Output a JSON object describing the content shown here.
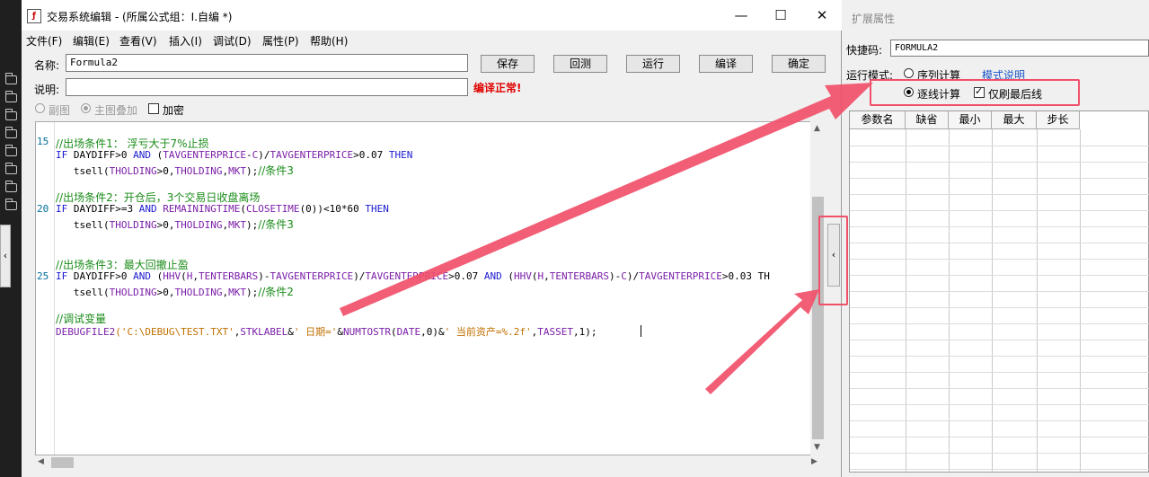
{
  "window": {
    "title": "交易系统编辑 - (所属公式组：I.自编 *)",
    "icon_name": "formula-app-icon",
    "minimize_glyph": "—",
    "maximize_glyph": "☐",
    "close_glyph": "✕"
  },
  "menu": [
    "文件(F)",
    "编辑(E)",
    "查看(V)",
    "插入(I)",
    "调试(D)",
    "属性(P)",
    "帮助(H)"
  ],
  "form": {
    "name_label": "名称:",
    "name_value": "Formula2",
    "desc_label": "说明:",
    "desc_value": "",
    "status": "编译正常!",
    "buttons": [
      "保存",
      "回测",
      "运行",
      "编译",
      "确定"
    ],
    "opt_sub": "副图",
    "opt_main": "主图叠加",
    "opt_encrypt": "加密"
  },
  "editor": {
    "line_numbers": [
      "15",
      "20",
      "25"
    ],
    "lines": [
      [
        {
          "t": "//出场条件1： 浮亏大于7%止损",
          "c": "cmt"
        }
      ],
      [
        {
          "t": "IF ",
          "c": "kw"
        },
        {
          "t": "DAYDIFF>0 "
        },
        {
          "t": "AND",
          "c": "kw"
        },
        {
          "t": " ("
        },
        {
          "t": "TAVGENTERPRICE",
          "c": "fn"
        },
        {
          "t": "-"
        },
        {
          "t": "C",
          "c": "fn"
        },
        {
          "t": ")/"
        },
        {
          "t": "TAVGENTERPRICE",
          "c": "fn"
        },
        {
          "t": ">0.07 "
        },
        {
          "t": "THEN",
          "c": "kw"
        }
      ],
      [
        {
          "t": "   tsell("
        },
        {
          "t": "THOLDING",
          "c": "fn"
        },
        {
          "t": ">0,"
        },
        {
          "t": "THOLDING",
          "c": "fn"
        },
        {
          "t": ","
        },
        {
          "t": "MKT",
          "c": "fn"
        },
        {
          "t": ");"
        },
        {
          "t": "//条件3",
          "c": "cmt"
        }
      ],
      [],
      [
        {
          "t": "//出场条件2：开仓后，3个交易日收盘离场",
          "c": "cmt"
        }
      ],
      [
        {
          "t": "IF ",
          "c": "kw"
        },
        {
          "t": "DAYDIFF>=3 "
        },
        {
          "t": "AND",
          "c": "kw"
        },
        {
          "t": " "
        },
        {
          "t": "REMAININGTIME",
          "c": "fn"
        },
        {
          "t": "("
        },
        {
          "t": "CLOSETIME",
          "c": "fn"
        },
        {
          "t": "(0))<10*60 "
        },
        {
          "t": "THEN",
          "c": "kw"
        }
      ],
      [
        {
          "t": "   tsell("
        },
        {
          "t": "THOLDING",
          "c": "fn"
        },
        {
          "t": ">0,"
        },
        {
          "t": "THOLDING",
          "c": "fn"
        },
        {
          "t": ","
        },
        {
          "t": "MKT",
          "c": "fn"
        },
        {
          "t": ");"
        },
        {
          "t": "//条件3",
          "c": "cmt"
        }
      ],
      [],
      [],
      [
        {
          "t": "//出场条件3：最大回撤止盈",
          "c": "cmt"
        }
      ],
      [
        {
          "t": "IF ",
          "c": "kw"
        },
        {
          "t": "DAYDIFF>0 "
        },
        {
          "t": "AND",
          "c": "kw"
        },
        {
          "t": " ("
        },
        {
          "t": "HHV",
          "c": "fn"
        },
        {
          "t": "("
        },
        {
          "t": "H",
          "c": "fn"
        },
        {
          "t": ","
        },
        {
          "t": "TENTERBARS",
          "c": "fn"
        },
        {
          "t": ")-"
        },
        {
          "t": "TAVGENTERPRICE",
          "c": "fn"
        },
        {
          "t": ")/"
        },
        {
          "t": "TAVGENTERPRICE",
          "c": "fn"
        },
        {
          "t": ">0.07 "
        },
        {
          "t": "AND",
          "c": "kw"
        },
        {
          "t": " ("
        },
        {
          "t": "HHV",
          "c": "fn"
        },
        {
          "t": "("
        },
        {
          "t": "H",
          "c": "fn"
        },
        {
          "t": ","
        },
        {
          "t": "TENTERBARS",
          "c": "fn"
        },
        {
          "t": ")-"
        },
        {
          "t": "C",
          "c": "fn"
        },
        {
          "t": ")/"
        },
        {
          "t": "TAVGENTERPRICE",
          "c": "fn"
        },
        {
          "t": ">0.03 TH"
        }
      ],
      [
        {
          "t": "   tsell("
        },
        {
          "t": "THOLDING",
          "c": "fn"
        },
        {
          "t": ">0,"
        },
        {
          "t": "THOLDING",
          "c": "fn"
        },
        {
          "t": ","
        },
        {
          "t": "MKT",
          "c": "fn"
        },
        {
          "t": ");"
        },
        {
          "t": "//条件2",
          "c": "cmt"
        }
      ],
      [],
      [
        {
          "t": "//调试变量",
          "c": "cmt"
        }
      ],
      [
        {
          "t": "DEBUGFILE2",
          "c": "fn"
        },
        {
          "t": "('C:\\DEBUG\\TEST.TXT'",
          "c": "str"
        },
        {
          "t": ","
        },
        {
          "t": "STKLABEL",
          "c": "fn"
        },
        {
          "t": "&"
        },
        {
          "t": "' 日期='",
          "c": "str"
        },
        {
          "t": "&"
        },
        {
          "t": "NUMTOSTR",
          "c": "fn"
        },
        {
          "t": "("
        },
        {
          "t": "DATE",
          "c": "fn"
        },
        {
          "t": ",0)&"
        },
        {
          "t": "' 当前资产=%.2f'",
          "c": "str"
        },
        {
          "t": ","
        },
        {
          "t": "TASSET",
          "c": "fn"
        },
        {
          "t": ",1);"
        }
      ]
    ]
  },
  "ext": {
    "title": "扩展属性",
    "shortcut_label": "快捷码:",
    "shortcut_value": "FORMULA2",
    "mode_label": "运行模式:",
    "mode_seq": "序列计算",
    "mode_help": "模式说明",
    "mode_line": "逐线计算",
    "only_last": "仅刷最后线",
    "columns": [
      "参数名",
      "缺省",
      "最小",
      "最大",
      "步长"
    ]
  },
  "colors": {
    "annotation": "#f0506a",
    "status_red": "#e00000",
    "link_blue": "#1a56c8"
  }
}
